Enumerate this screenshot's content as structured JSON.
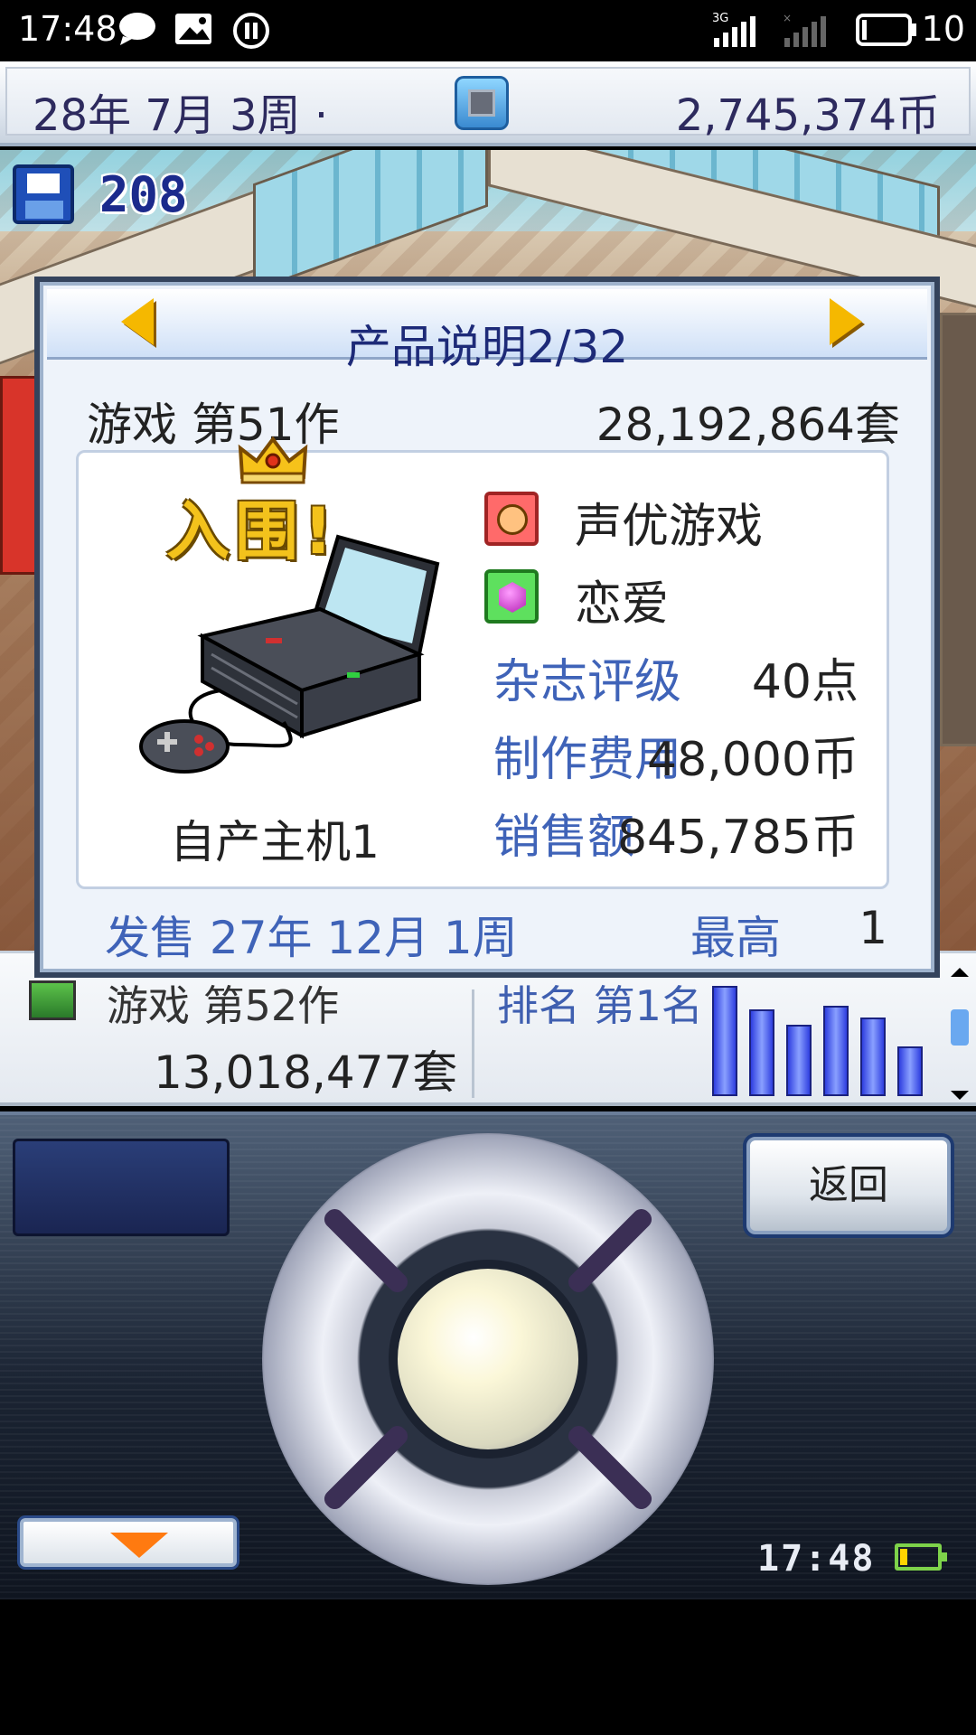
{
  "status_bar": {
    "time": "17:48",
    "battery_text": "10",
    "network_label": "3G",
    "icons": [
      "chat-bubble-icon",
      "image-icon",
      "pause-circle-icon",
      "signal-3g-icon",
      "signal-no-sim-icon",
      "battery-icon"
    ]
  },
  "topbar": {
    "date": "28年 7月 3周 ·",
    "money": "2,745,374币"
  },
  "scene": {
    "save_count": "208"
  },
  "dialog": {
    "title": "产品说明2/32",
    "genre_line": "游戏 第51作",
    "units_sold": "28,192,864套",
    "nominated_label": "入围!",
    "console_name": "自产主机1",
    "features": [
      {
        "label": "声优游戏",
        "icon": "voice-actor-icon"
      },
      {
        "label": "恋爱",
        "icon": "romance-gem-icon"
      }
    ],
    "stats": {
      "magazine_label": "杂志评级",
      "magazine_value": "40点",
      "cost_label": "制作费用",
      "cost_value": "48,000币",
      "revenue_label": "销售额",
      "revenue_value": "845,785币"
    },
    "release": "发售 27年 12月 1周",
    "best_label": "最高",
    "best_value": "1"
  },
  "list_row": {
    "title": "游戏 第52作",
    "sales": "13,018,477套",
    "rank": "排名 第1名",
    "bar_levels": [
      0.95,
      0.75,
      0.62,
      0.78,
      0.68,
      0.43
    ]
  },
  "controller": {
    "back_label": "返回",
    "clock": "17:48"
  },
  "colors": {
    "accent_blue": "#3f63b8",
    "title_navy": "#1d2a78",
    "gold": "#f3c21c"
  }
}
